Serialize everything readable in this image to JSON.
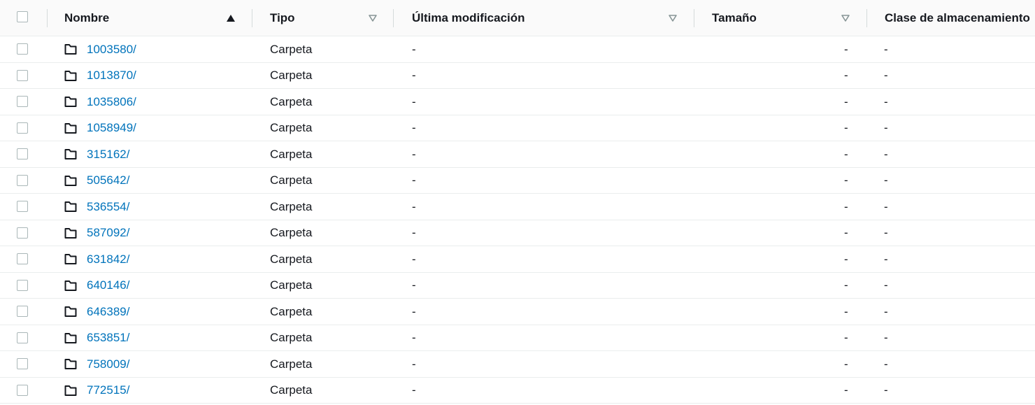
{
  "columns": {
    "name": "Nombre",
    "type": "Tipo",
    "modified": "Última modificación",
    "size": "Tamaño",
    "storage_class": "Clase de almacenamiento"
  },
  "icons": {
    "sort_ascending": "triangle-up-icon",
    "sort_unsorted": "triangle-down-outline-icon",
    "folder": "folder-icon"
  },
  "colors": {
    "link": "#0073bb",
    "header_bg": "#fafafa"
  },
  "rows": [
    {
      "name": "1003580/",
      "type": "Carpeta",
      "modified": "-",
      "size": "-",
      "storage_class": "-"
    },
    {
      "name": "1013870/",
      "type": "Carpeta",
      "modified": "-",
      "size": "-",
      "storage_class": "-"
    },
    {
      "name": "1035806/",
      "type": "Carpeta",
      "modified": "-",
      "size": "-",
      "storage_class": "-"
    },
    {
      "name": "1058949/",
      "type": "Carpeta",
      "modified": "-",
      "size": "-",
      "storage_class": "-"
    },
    {
      "name": "315162/",
      "type": "Carpeta",
      "modified": "-",
      "size": "-",
      "storage_class": "-"
    },
    {
      "name": "505642/",
      "type": "Carpeta",
      "modified": "-",
      "size": "-",
      "storage_class": "-"
    },
    {
      "name": "536554/",
      "type": "Carpeta",
      "modified": "-",
      "size": "-",
      "storage_class": "-"
    },
    {
      "name": "587092/",
      "type": "Carpeta",
      "modified": "-",
      "size": "-",
      "storage_class": "-"
    },
    {
      "name": "631842/",
      "type": "Carpeta",
      "modified": "-",
      "size": "-",
      "storage_class": "-"
    },
    {
      "name": "640146/",
      "type": "Carpeta",
      "modified": "-",
      "size": "-",
      "storage_class": "-"
    },
    {
      "name": "646389/",
      "type": "Carpeta",
      "modified": "-",
      "size": "-",
      "storage_class": "-"
    },
    {
      "name": "653851/",
      "type": "Carpeta",
      "modified": "-",
      "size": "-",
      "storage_class": "-"
    },
    {
      "name": "758009/",
      "type": "Carpeta",
      "modified": "-",
      "size": "-",
      "storage_class": "-"
    },
    {
      "name": "772515/",
      "type": "Carpeta",
      "modified": "-",
      "size": "-",
      "storage_class": "-"
    }
  ]
}
